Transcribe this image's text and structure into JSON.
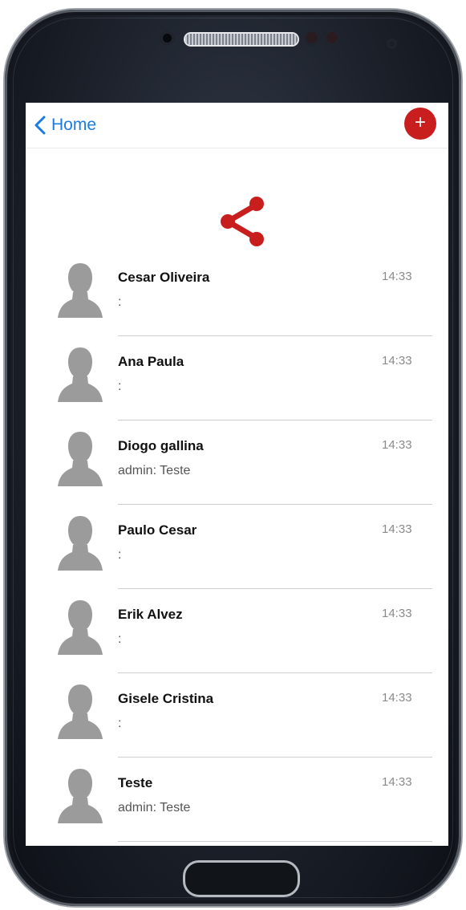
{
  "nav": {
    "back_label": "Home",
    "add_label": "+"
  },
  "contacts": [
    {
      "name": "Cesar Oliveira",
      "message": ":",
      "time": "14:33"
    },
    {
      "name": "Ana Paula",
      "message": ":",
      "time": "14:33"
    },
    {
      "name": "Diogo gallina",
      "message": "admin: Teste",
      "time": "14:33"
    },
    {
      "name": "Paulo Cesar",
      "message": ":",
      "time": "14:33"
    },
    {
      "name": "Erik Alvez",
      "message": ":",
      "time": "14:33"
    },
    {
      "name": "Gisele Cristina",
      "message": ":",
      "time": "14:33"
    },
    {
      "name": "Teste",
      "message": "admin: Teste",
      "time": "14:33"
    }
  ],
  "colors": {
    "accent": "#c81e1e",
    "link": "#1a7ce3",
    "avatar": "#9b9b9b"
  }
}
